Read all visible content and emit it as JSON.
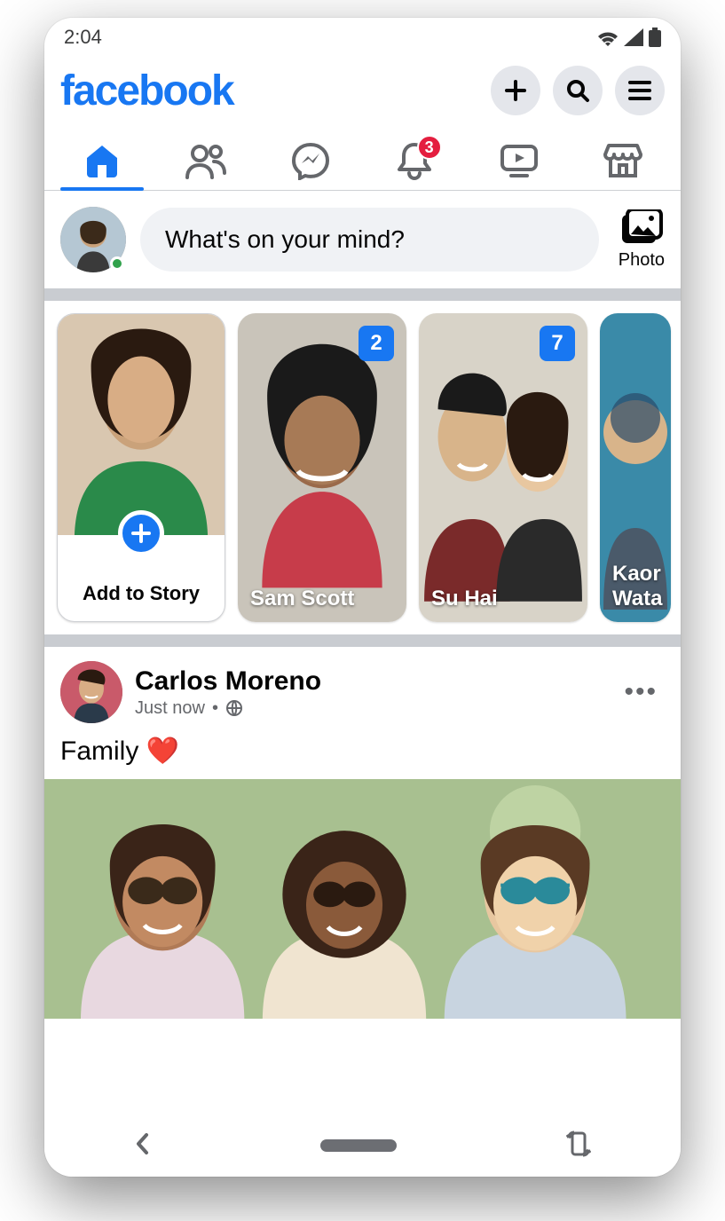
{
  "status": {
    "time": "2:04"
  },
  "header": {
    "logo": "facebook"
  },
  "tabs": {
    "notifications_count": "3"
  },
  "composer": {
    "placeholder": "What's on your mind?",
    "photo_label": "Photo"
  },
  "stories": {
    "add_label": "Add to Story",
    "items": [
      {
        "name": "Sam Scott",
        "count": "2"
      },
      {
        "name": "Su Hai",
        "count": "7"
      },
      {
        "name": "Kaor Wata",
        "count": ""
      }
    ]
  },
  "post": {
    "author": "Carlos Moreno",
    "time": "Just now",
    "sep": "•",
    "text": "Family ❤️"
  }
}
